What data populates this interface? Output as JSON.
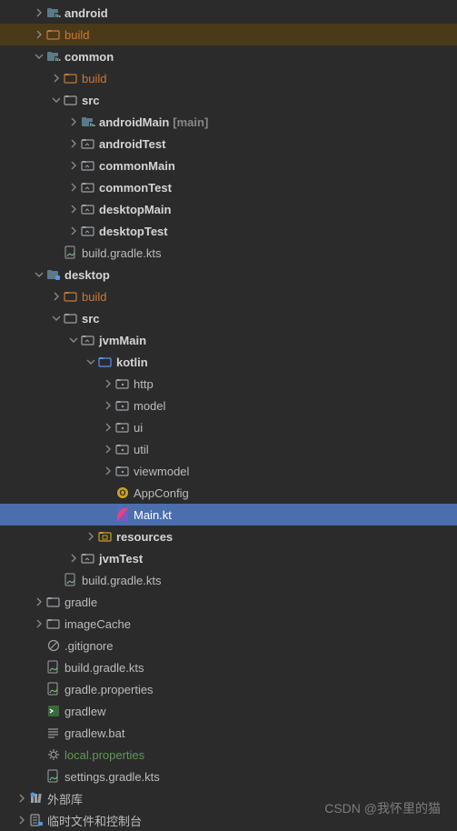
{
  "tree": [
    {
      "depth": 1,
      "arrow": "right",
      "icon": "module-folder",
      "label": "android",
      "bold": true
    },
    {
      "depth": 1,
      "arrow": "right",
      "icon": "folder-orange",
      "label": "build",
      "orange": true,
      "highlighted": true
    },
    {
      "depth": 1,
      "arrow": "down",
      "icon": "module-folder",
      "label": "common",
      "bold": true
    },
    {
      "depth": 2,
      "arrow": "right",
      "icon": "folder-orange",
      "label": "build",
      "orange": true
    },
    {
      "depth": 2,
      "arrow": "down",
      "icon": "folder",
      "label": "src",
      "bold": true
    },
    {
      "depth": 3,
      "arrow": "right",
      "icon": "module-source",
      "label": "androidMain",
      "bold": true,
      "annotation": "[main]"
    },
    {
      "depth": 3,
      "arrow": "right",
      "icon": "folder-outline",
      "label": "androidTest",
      "bold": true
    },
    {
      "depth": 3,
      "arrow": "right",
      "icon": "folder-outline",
      "label": "commonMain",
      "bold": true
    },
    {
      "depth": 3,
      "arrow": "right",
      "icon": "folder-outline",
      "label": "commonTest",
      "bold": true
    },
    {
      "depth": 3,
      "arrow": "right",
      "icon": "folder-outline",
      "label": "desktopMain",
      "bold": true
    },
    {
      "depth": 3,
      "arrow": "right",
      "icon": "folder-outline",
      "label": "desktopTest",
      "bold": true
    },
    {
      "depth": 2,
      "arrow": "none",
      "icon": "gradle-file",
      "label": "build.gradle.kts"
    },
    {
      "depth": 1,
      "arrow": "down",
      "icon": "module-folder-blue",
      "label": "desktop",
      "bold": true
    },
    {
      "depth": 2,
      "arrow": "right",
      "icon": "folder-orange",
      "label": "build",
      "orange": true
    },
    {
      "depth": 2,
      "arrow": "down",
      "icon": "folder",
      "label": "src",
      "bold": true
    },
    {
      "depth": 3,
      "arrow": "down",
      "icon": "folder-outline",
      "label": "jvmMain",
      "bold": true
    },
    {
      "depth": 4,
      "arrow": "down",
      "icon": "folder-blue",
      "label": "kotlin",
      "bold": true
    },
    {
      "depth": 5,
      "arrow": "right",
      "icon": "package",
      "label": "http"
    },
    {
      "depth": 5,
      "arrow": "right",
      "icon": "package",
      "label": "model"
    },
    {
      "depth": 5,
      "arrow": "right",
      "icon": "package",
      "label": "ui"
    },
    {
      "depth": 5,
      "arrow": "right",
      "icon": "package",
      "label": "util"
    },
    {
      "depth": 5,
      "arrow": "right",
      "icon": "package",
      "label": "viewmodel"
    },
    {
      "depth": 5,
      "arrow": "none",
      "icon": "kotlin-object",
      "label": "AppConfig"
    },
    {
      "depth": 5,
      "arrow": "none",
      "icon": "kotlin-file",
      "label": "Main.kt",
      "selected": true
    },
    {
      "depth": 4,
      "arrow": "right",
      "icon": "resources",
      "label": "resources",
      "bold": true
    },
    {
      "depth": 3,
      "arrow": "right",
      "icon": "folder-outline",
      "label": "jvmTest",
      "bold": true
    },
    {
      "depth": 2,
      "arrow": "none",
      "icon": "gradle-file",
      "label": "build.gradle.kts"
    },
    {
      "depth": 1,
      "arrow": "right",
      "icon": "folder",
      "label": "gradle"
    },
    {
      "depth": 1,
      "arrow": "right",
      "icon": "folder",
      "label": "imageCache"
    },
    {
      "depth": 1,
      "arrow": "none",
      "icon": "gitignore",
      "label": ".gitignore"
    },
    {
      "depth": 1,
      "arrow": "none",
      "icon": "gradle-file",
      "label": "build.gradle.kts"
    },
    {
      "depth": 1,
      "arrow": "none",
      "icon": "gradle-file",
      "label": "gradle.properties"
    },
    {
      "depth": 1,
      "arrow": "none",
      "icon": "shell",
      "label": "gradlew"
    },
    {
      "depth": 1,
      "arrow": "none",
      "icon": "text-file",
      "label": "gradlew.bat"
    },
    {
      "depth": 1,
      "arrow": "none",
      "icon": "gear",
      "label": "local.properties",
      "green": true
    },
    {
      "depth": 1,
      "arrow": "none",
      "icon": "gradle-file",
      "label": "settings.gradle.kts"
    },
    {
      "depth": 0,
      "arrow": "right",
      "icon": "library",
      "label": "外部库"
    },
    {
      "depth": 0,
      "arrow": "right",
      "icon": "scratch",
      "label": "临时文件和控制台"
    }
  ],
  "watermark": "CSDN @我怀里的猫",
  "indentUnit": 19,
  "baseIndent": 16
}
